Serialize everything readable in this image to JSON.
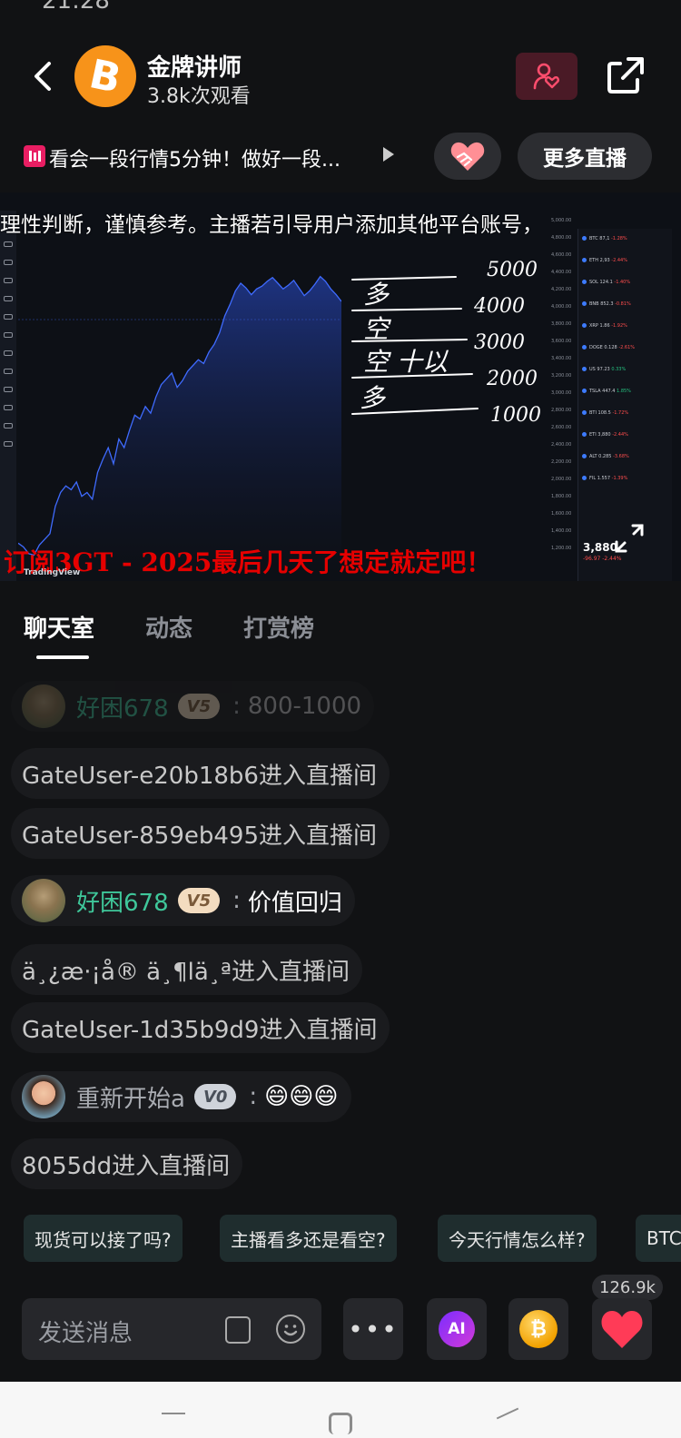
{
  "status_bar": {
    "time": "21:28"
  },
  "header": {
    "host_name": "金牌讲师",
    "viewers": "3.8k次观看",
    "avatar_symbol": "B",
    "icons": {
      "back": "back-arrow-icon",
      "follow": "person-heart-icon",
      "share": "share-icon"
    },
    "colors": {
      "avatar": "#f7931a",
      "follow_bg": "#4a1a26",
      "follow_accent": "#ff4d6d"
    }
  },
  "announcement": {
    "text": "看会一段行情5分钟！做好一段...",
    "more_live_label": "更多直播",
    "like_icon": "handshake-heart-icon"
  },
  "video": {
    "overlay_top": "理性判断，谨慎参考。主播若引导用户添加其他平台账号，",
    "overlay_bottom": "订阅3GT - 2025最后几天了想定就定吧！",
    "handwritten_levels": [
      "5000",
      "4000",
      "3000",
      "2000",
      "1000"
    ],
    "handwritten_notes": [
      "多",
      "空",
      "空 十以",
      "多"
    ],
    "tradingview_logo": "TradingView",
    "price": "3,880",
    "change": "-96.97 -2.44%",
    "axis_ticks": [
      "5,000.00",
      "4,800.00",
      "4,600.00",
      "4,400.00",
      "4,200.00",
      "4,000.00",
      "3,800.00",
      "3,600.00",
      "3,400.00",
      "3,200.00",
      "3,000.00",
      "2,800.00",
      "2,600.00",
      "2,400.00",
      "2,200.00",
      "2,000.00",
      "1,800.00",
      "1,600.00",
      "1,400.00",
      "1,200.00"
    ],
    "watchlist": [
      {
        "sym": "BTC",
        "px": "87,1",
        "chg": "-1.28%"
      },
      {
        "sym": "ETH",
        "px": "2,93",
        "chg": "-2.44%"
      },
      {
        "sym": "SOL",
        "px": "124.1",
        "chg": "-1.40%"
      },
      {
        "sym": "BNB",
        "px": "852.3",
        "chg": "-0.81%"
      },
      {
        "sym": "XRP",
        "px": "1.86",
        "chg": "-1.92%"
      },
      {
        "sym": "DOGE",
        "px": "0.128",
        "chg": "-2.61%"
      },
      {
        "sym": "US",
        "px": "97.23",
        "chg": "0.33%"
      },
      {
        "sym": "TSLA",
        "px": "447.4",
        "chg": "1.85%"
      },
      {
        "sym": "BTI",
        "px": "108.5",
        "chg": "-1.72%"
      },
      {
        "sym": "ETI",
        "px": "3,880",
        "chg": "-2.44%"
      },
      {
        "sym": "ALT",
        "px": "0.285",
        "chg": "-3.68%"
      },
      {
        "sym": "FIL",
        "px": "1.557",
        "chg": "-1.39%"
      }
    ],
    "fullscreen_icon": "expand-icon",
    "chart_series": [
      1520,
      1480,
      1410,
      1395,
      1500,
      1560,
      1620,
      1905,
      2050,
      2120,
      2080,
      2160,
      2010,
      2050,
      1980,
      2260,
      2400,
      2520,
      2350,
      2610,
      2520,
      2700,
      2860,
      2820,
      2950,
      2880,
      3050,
      3180,
      3240,
      3300,
      3150,
      3220,
      3320,
      3380,
      3440,
      3400,
      3520,
      3600,
      3720,
      3900,
      4020,
      4160,
      4240,
      4190,
      4120,
      4180,
      4210,
      4260,
      4300,
      4240,
      4180,
      4220,
      4270,
      4190,
      4110,
      4160,
      4230,
      4310,
      4260,
      4180,
      4120,
      4050
    ]
  },
  "tabs": [
    "聊天室",
    "动态",
    "打赏榜"
  ],
  "chat": [
    {
      "type": "user",
      "user": "好困678",
      "level": "V5",
      "text": "800-1000",
      "faded": true,
      "avatar": "monkey-avatar"
    },
    {
      "type": "system",
      "text": "GateUser-e20b18b6进入直播间"
    },
    {
      "type": "system",
      "text": "GateUser-859eb495进入直播间"
    },
    {
      "type": "user",
      "user": "好困678",
      "level": "V5",
      "text": "价值回归",
      "avatar": "monkey-avatar"
    },
    {
      "type": "system",
      "text": "ä¸¿æ·¡å®   ä¸¶lä¸ª进入直播间"
    },
    {
      "type": "system",
      "text": "GateUser-1d35b9d9进入直播间"
    },
    {
      "type": "user",
      "user": "重新开始a",
      "level": "V0",
      "text": "😄😄😄",
      "avatar": "person-avatar"
    },
    {
      "type": "system",
      "text": "8055dd进入直播间"
    }
  ],
  "suggestions": [
    "现货可以接了吗?",
    "主播看多还是看空?",
    "今天行情怎么样?",
    "BTC"
  ],
  "bottom_bar": {
    "placeholder": "发送消息",
    "like_count": "126.9k",
    "ai_label": "AI",
    "coin_symbol": "₿",
    "icons": [
      "sticker-icon",
      "emoji-icon",
      "more-dots-icon",
      "ai-icon",
      "coin-icon",
      "heart-icon"
    ]
  }
}
